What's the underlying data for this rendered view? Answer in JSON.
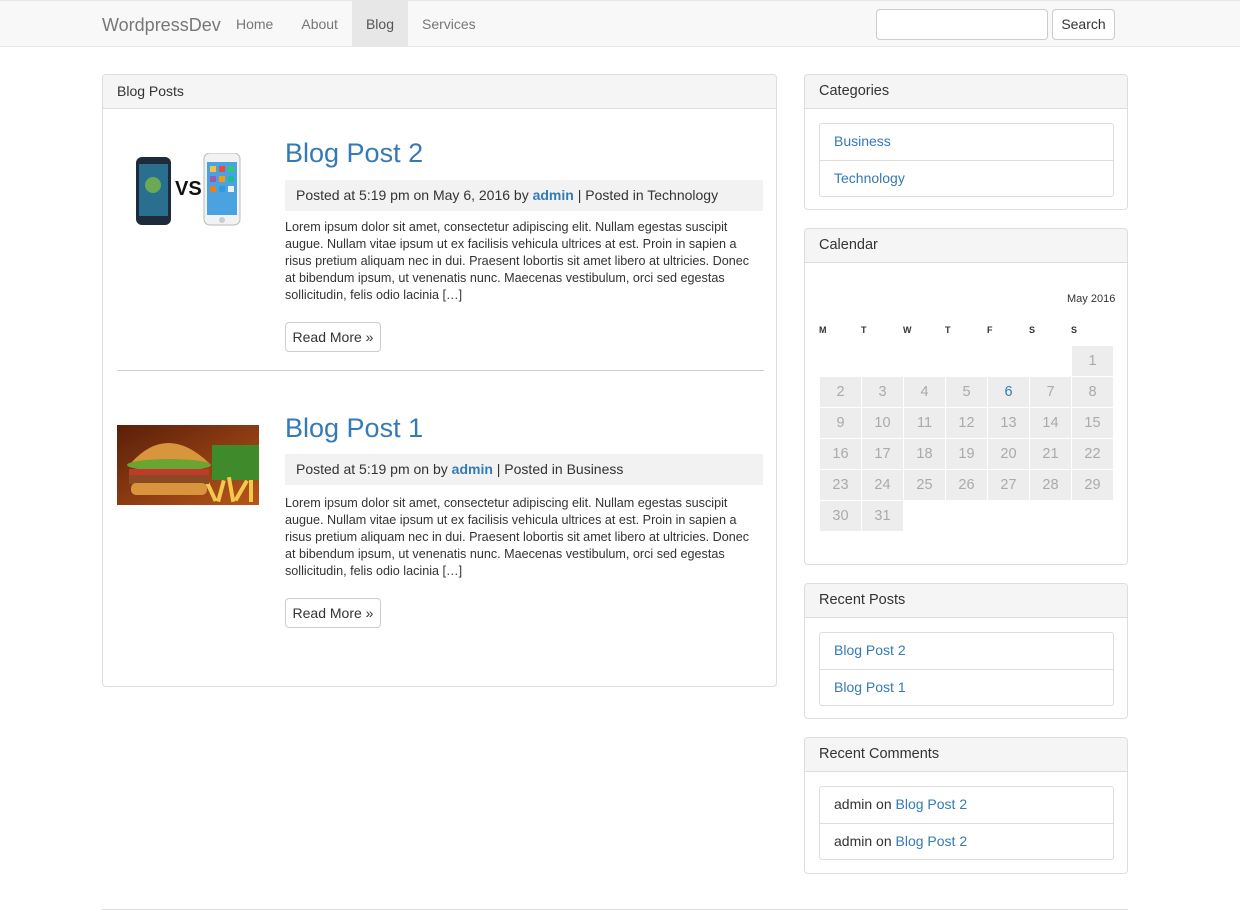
{
  "navbar": {
    "brand": "WordpressDev",
    "items": [
      {
        "label": "Home",
        "active": false
      },
      {
        "label": "About",
        "active": false
      },
      {
        "label": "Blog",
        "active": true
      },
      {
        "label": "Services",
        "active": false
      }
    ],
    "search_value": "",
    "search_button": "Search"
  },
  "main": {
    "heading": "Blog Posts",
    "posts": [
      {
        "title": "Blog Post 2",
        "meta_prefix": "Posted at 5:19 pm on May 6, 2016 by",
        "author": "admin",
        "meta_suffix": "| Posted in Technology",
        "excerpt": "Lorem ipsum dolor sit amet, consectetur adipiscing elit. Nullam egestas suscipit augue. Nullam vitae ipsum ut ex facilisis vehicula ultrices at est. Proin in sapien a risus pretium aliquam nec in dui. Praesent lobortis sit amet libero at ultricies. Donec at bibendum ipsum, ut venenatis nunc. Maecenas vestibulum, orci sed egestas sollicitudin, felis odio lacinia […]",
        "read_more": "Read More »",
        "thumb_icon": "phones-vs-image"
      },
      {
        "title": "Blog Post 1",
        "meta_prefix": "Posted at 5:19 pm on by",
        "author": "admin",
        "meta_suffix": "| Posted in Business",
        "excerpt": "Lorem ipsum dolor sit amet, consectetur adipiscing elit. Nullam egestas suscipit augue. Nullam vitae ipsum ut ex facilisis vehicula ultrices at est. Proin in sapien a risus pretium aliquam nec in dui. Praesent lobortis sit amet libero at ultricies. Donec at bibendum ipsum, ut venenatis nunc. Maecenas vestibulum, orci sed egestas sollicitudin, felis odio lacinia […]",
        "read_more": "Read More »",
        "thumb_icon": "burger-image"
      }
    ]
  },
  "sidebar": {
    "categories": {
      "heading": "Categories",
      "items": [
        "Business",
        "Technology"
      ]
    },
    "calendar": {
      "heading": "Calendar",
      "caption": "May 2016",
      "weekdays": [
        "M",
        "T",
        "W",
        "T",
        "F",
        "S",
        "S"
      ],
      "today": "6",
      "weeks": [
        [
          "",
          "",
          "",
          "",
          "",
          "",
          "1"
        ],
        [
          "2",
          "3",
          "4",
          "5",
          "6",
          "7",
          "8"
        ],
        [
          "9",
          "10",
          "11",
          "12",
          "13",
          "14",
          "15"
        ],
        [
          "16",
          "17",
          "18",
          "19",
          "20",
          "21",
          "22"
        ],
        [
          "23",
          "24",
          "25",
          "26",
          "27",
          "28",
          "29"
        ],
        [
          "30",
          "31",
          "",
          "",
          "",
          "",
          ""
        ]
      ]
    },
    "recent_posts": {
      "heading": "Recent Posts",
      "items": [
        "Blog Post 2",
        "Blog Post 1"
      ]
    },
    "recent_comments": {
      "heading": "Recent Comments",
      "items": [
        {
          "author": "admin",
          "on": "on",
          "post": "Blog Post 2"
        },
        {
          "author": "admin",
          "on": "on",
          "post": "Blog Post 2"
        }
      ]
    }
  },
  "colors": {
    "link": "#337ab7",
    "navbar_bg": "#f8f8f8",
    "panel_heading_bg": "#f5f5f5"
  }
}
